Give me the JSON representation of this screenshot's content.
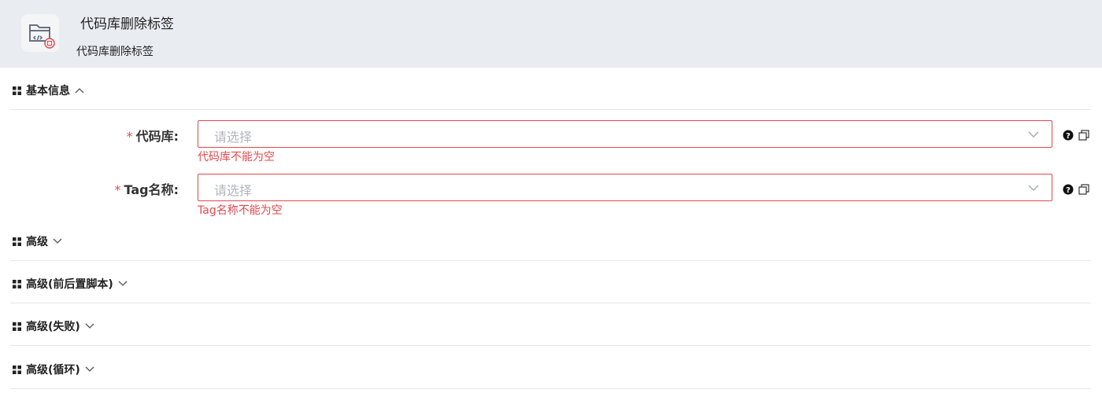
{
  "header": {
    "title": "代码库删除标签",
    "subtitle": "代码库删除标签",
    "logo_icon": "folder-tag-icon"
  },
  "sections": {
    "basic": {
      "label": "基本信息",
      "expanded": true
    },
    "advanced": {
      "label": "高级",
      "expanded": false
    },
    "advanced_script": {
      "label": "高级(前后置脚本)",
      "expanded": false
    },
    "advanced_failure": {
      "label": "高级(失败)",
      "expanded": false
    },
    "advanced_loop": {
      "label": "高级(循环)",
      "expanded": false
    }
  },
  "form": {
    "repo": {
      "required_mark": "*",
      "label": "代码库:",
      "placeholder": "请选择",
      "error": "代码库不能为空"
    },
    "tag": {
      "required_mark": "*",
      "label": "Tag名称:",
      "placeholder": "请选择",
      "error": "Tag名称不能为空"
    }
  },
  "colors": {
    "header_bg": "#e9ecf1",
    "error": "#e5484d",
    "placeholder": "#b3b6bc",
    "divider": "#e3e5e8"
  }
}
